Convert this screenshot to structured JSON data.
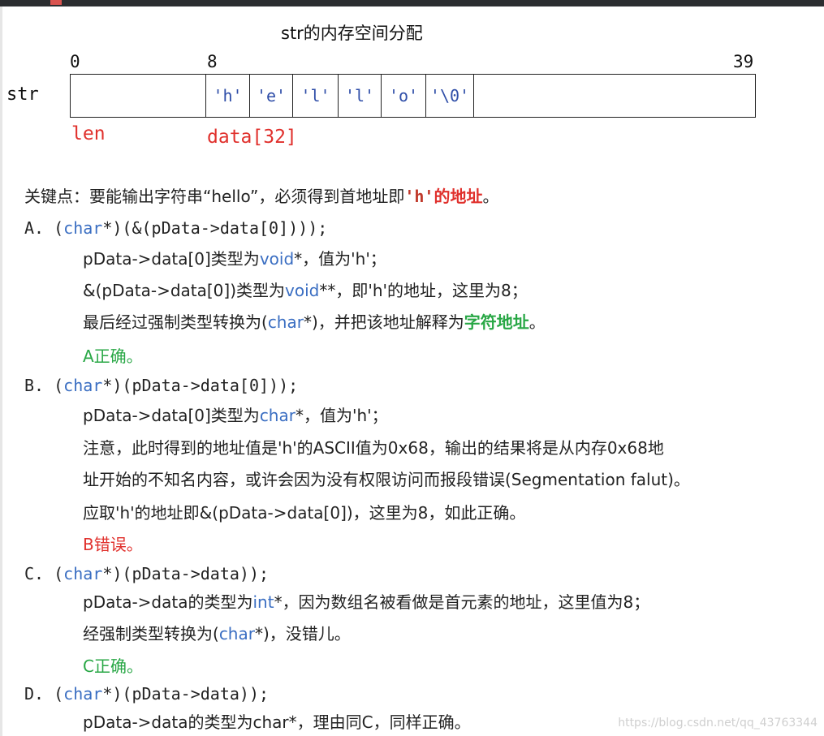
{
  "diagram": {
    "title": "str的内存空间分配",
    "ticks": [
      "0",
      "8",
      "39"
    ],
    "var_label": "str",
    "cells": [
      "'h'",
      "'e'",
      "'l'",
      "'l'",
      "'o'",
      "'\\0'"
    ],
    "len_label": "len",
    "data_label": "data[32]"
  },
  "text": {
    "key_prefix": "关键点：要能输出字符串“hello”，必须得到首地址即",
    "key_code": "'h'",
    "key_bold": "的地址",
    "key_end": "。",
    "a": {
      "head_pre": "A. (",
      "head_kw": "char",
      "head_post": "*)(&(pData->data[0])));",
      "l1_pre": "pData->data[0]类型为",
      "l1_kw": "void",
      "l1_post": "*，值为'h'；",
      "l2_pre": "&(pData->data[0])类型为",
      "l2_kw": "void",
      "l2_post": "**，即'h'的地址，这里为8；",
      "l3_pre": "最后经过强制类型转换为(",
      "l3_kw": "char",
      "l3_mid": "*)，并把该地址解释为",
      "l3_bold": "字符地址",
      "l3_end": "。",
      "verdict": "A正确。"
    },
    "b": {
      "head_pre": "B. (",
      "head_kw": "char",
      "head_post": "*)(pData->data[0]));",
      "l1_pre": "pData->data[0]类型为",
      "l1_kw": "char",
      "l1_post": "*，值为'h'；",
      "l2": "注意，此时得到的地址值是'h'的ASCII值为0x68，输出的结果将是从内存0x68地",
      "l3": "址开始的不知名内容，或许会因为没有权限访问而报段错误(Segmentation falut)。",
      "l4": "应取'h'的地址即&(pData->data[0])，这里为8，如此正确。",
      "verdict": "B错误。"
    },
    "c": {
      "head_pre": "C. (",
      "head_kw": "char",
      "head_post": "*)(pData->data));",
      "l1_pre": "pData->data的类型为",
      "l1_kw": "int",
      "l1_post": "*，因为数组名被看做是首元素的地址，这里值为8；",
      "l2_pre": "经强制类型转换为(",
      "l2_kw": "char",
      "l2_post": "*)，没错儿。",
      "verdict": "C正确。"
    },
    "d": {
      "head_pre": "D. (",
      "head_kw": "char",
      "head_post": "*)(pData->data));",
      "l1": "pData->data的类型为char*，理由同C，同样正确。"
    }
  },
  "watermark": "https://blog.csdn.net/qq_43763344",
  "colors": {
    "keyword": "#3a6ec2",
    "error_red": "#e0302c",
    "ok_green": "#28a745"
  }
}
